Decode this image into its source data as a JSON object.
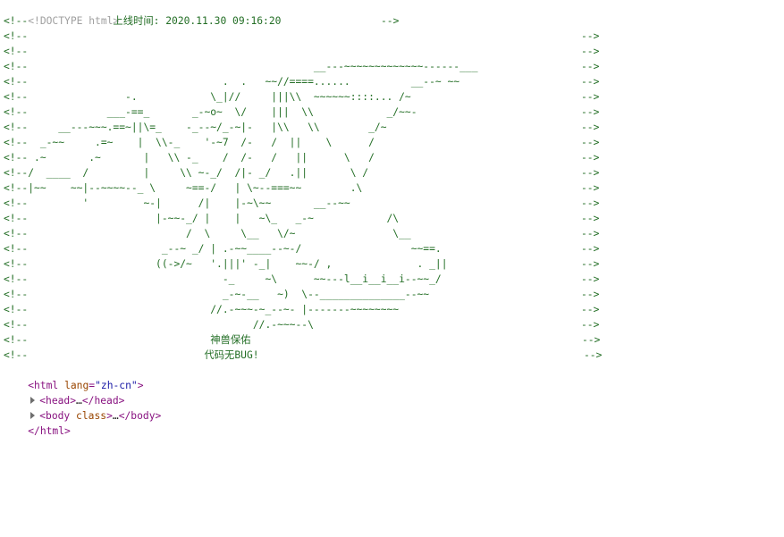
{
  "devtools": {
    "doctype": "<!DOCTYPE html>",
    "comment_open": "<!--",
    "comment_close": "-->",
    "comment_lines": [
      {
        "text": "              上线时间: 2020.11.30 09:16:20                 ",
        "close": "-->"
      },
      {
        "text": "",
        "close": "-->"
      },
      {
        "text": "",
        "close": "-->"
      },
      {
        "text": "                                               __---~~~~~~~~~~~~~------___",
        "close": "-->"
      },
      {
        "text": "                                .  .   ~~//====......          __--~ ~~",
        "close": "-->"
      },
      {
        "text": "                -.            \\_|//     |||\\\\  ~~~~~~::::... /~",
        "close": "-->"
      },
      {
        "text": "             ___-==_       _-~o~  \\/    |||  \\\\            _/~~-",
        "close": "-->"
      },
      {
        "text": "     __---~~~.==~||\\=_    -_--~/_-~|-   |\\\\   \\\\        _/~",
        "close": "-->"
      },
      {
        "text": "  _-~~     .=~    |  \\\\-_    '-~7  /-   /  ||    \\      /",
        "close": "-->"
      },
      {
        "text": " .~       .~       |   \\\\ -_    /  /-   /   ||      \\   /",
        "close": "-->"
      },
      {
        "text": "/  ____  /         |     \\\\ ~-_/  /|- _/   .||       \\ /",
        "close": "-->"
      },
      {
        "text": "|~~    ~~|--~~~~--_ \\     ~==-/   | \\~--===~~        .\\",
        "close": "-->"
      },
      {
        "text": "         '         ~-|      /|    |-~\\~~       __--~~",
        "close": "-->"
      },
      {
        "text": "                     |-~~-_/ |    |   ~\\_   _-~            /\\",
        "close": "-->"
      },
      {
        "text": "                          /  \\     \\__   \\/~                \\__",
        "close": "-->"
      },
      {
        "text": "                      _--~ _/ | .-~~____--~-/                  ~~==.",
        "close": "-->"
      },
      {
        "text": "                     ((->/~   '.|||' -_|    ~~-/ ,              . _||",
        "close": "-->"
      },
      {
        "text": "                                -_     ~\\      ~~---l__i__i__i--~~_/",
        "close": "-->"
      },
      {
        "text": "                                _-~-__   ~)  \\--______________--~~",
        "close": "-->"
      },
      {
        "text": "                              //.-~~~-~_--~- |-------~~~~~~~~",
        "close": "-->"
      },
      {
        "text": "                                     //.-~~~--\\",
        "close": "-->"
      },
      {
        "text": "                              神兽保佑",
        "close": "-->"
      },
      {
        "text": "                             代码无BUG!",
        "close": "-->"
      }
    ],
    "html_open": {
      "tag": "html",
      "attr_name": "lang",
      "attr_value": "\"zh-cn\""
    },
    "head_node": {
      "open": "<head>",
      "ellipsis": "…",
      "close": "</head>"
    },
    "body_node": {
      "open_start": "<body",
      "attr_name": "class",
      "open_end": ">",
      "ellipsis": "…",
      "close": "</body>"
    },
    "html_close": "</html>"
  }
}
